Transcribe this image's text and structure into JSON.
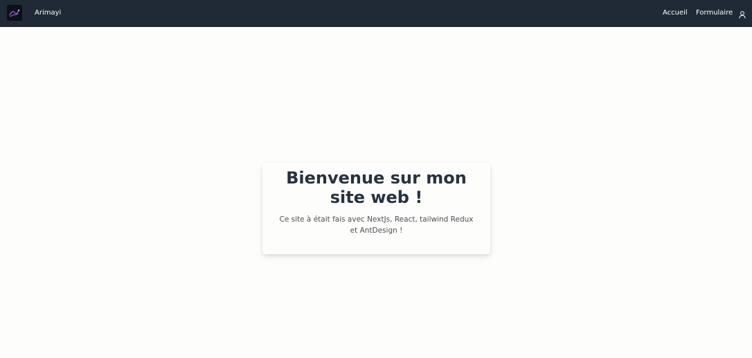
{
  "navbar": {
    "brand": "Arimayi",
    "links": [
      "Accueil",
      "Formulaire"
    ],
    "user_icon": "user-icon",
    "logo_icon": "logo-icon",
    "background": "#1f2a36"
  },
  "hero": {
    "title": "Bienvenue sur mon site web !",
    "description": "Ce site à était fais avec NextJs, React, tailwind Redux et AntDesign !"
  },
  "colors": {
    "title": "#26323f",
    "text": "#4a4f55",
    "page_background": "#fdfdfc"
  }
}
